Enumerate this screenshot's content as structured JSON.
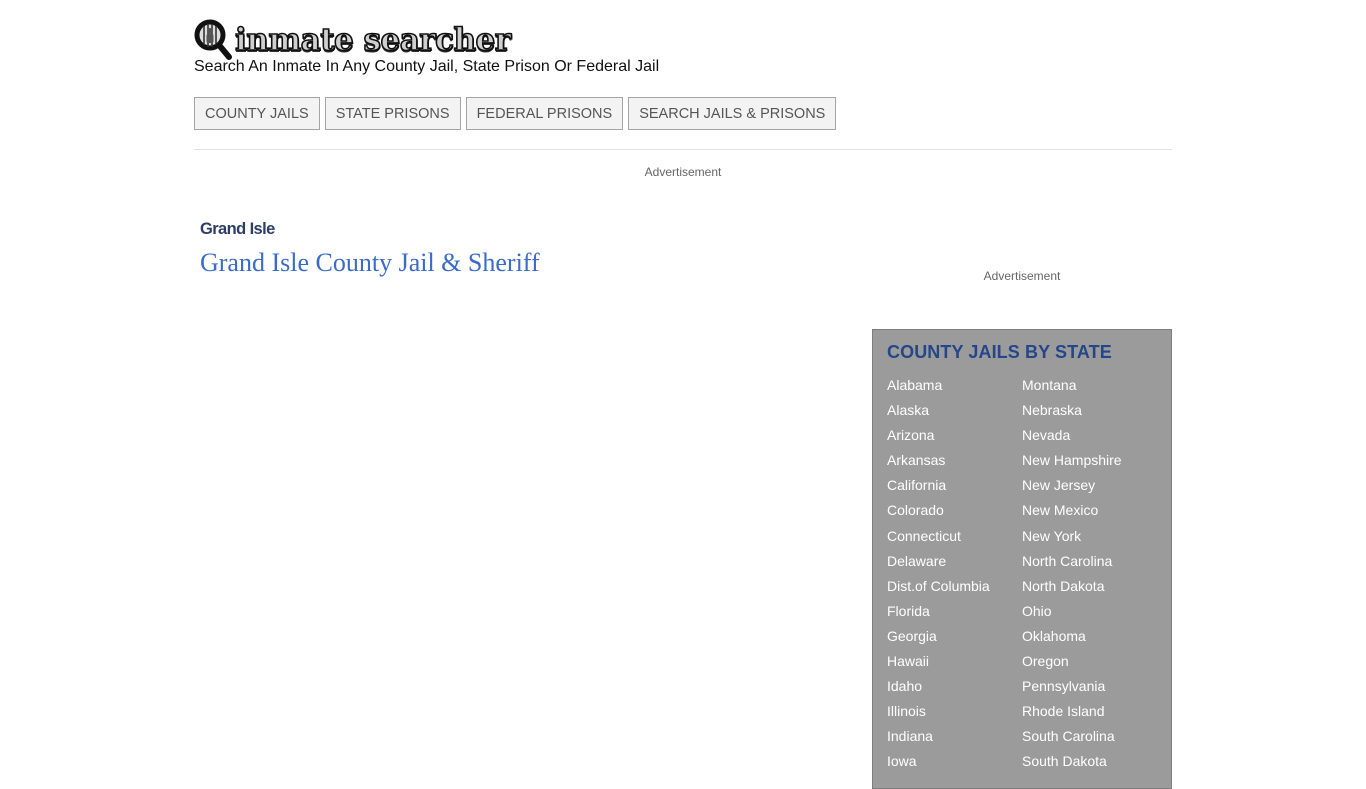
{
  "header": {
    "logo_text": "inmate searcher",
    "logo_icon": "magnifier-inmate-icon",
    "tagline": "Search An Inmate In Any County Jail, State Prison Or Federal Jail"
  },
  "nav": {
    "items": [
      {
        "label": "COUNTY JAILS"
      },
      {
        "label": "STATE PRISONS"
      },
      {
        "label": "FEDERAL PRISONS"
      },
      {
        "label": "SEARCH JAILS & PRISONS"
      }
    ]
  },
  "ads": {
    "top_label": "Advertisement",
    "side_label": "Advertisement"
  },
  "main": {
    "breadcrumb": "Grand Isle",
    "title": "Grand Isle County Jail & Sheriff"
  },
  "sidebar": {
    "heading": "COUNTY JAILS BY STATE",
    "column1": [
      "Alabama",
      "Alaska",
      "Arizona",
      "Arkansas",
      "California",
      "Colorado",
      "Connecticut",
      "Delaware",
      "Dist.of Columbia",
      "Florida",
      "Georgia",
      "Hawaii",
      "Idaho",
      "Illinois",
      "Indiana",
      "Iowa"
    ],
    "column2": [
      "Montana",
      "Nebraska",
      "Nevada",
      "New Hampshire",
      "New Jersey",
      "New Mexico",
      "New York",
      "North Carolina",
      "North Dakota",
      "Ohio",
      "Oklahoma",
      "Oregon",
      "Pennsylvania",
      "Rhode Island",
      "South Carolina",
      "South Dakota"
    ]
  },
  "colors": {
    "breadcrumb": "#2c3e66",
    "title_link": "#3a6bc9",
    "sidebar_bg": "#9b9b9b",
    "sidebar_heading": "#25468a"
  }
}
